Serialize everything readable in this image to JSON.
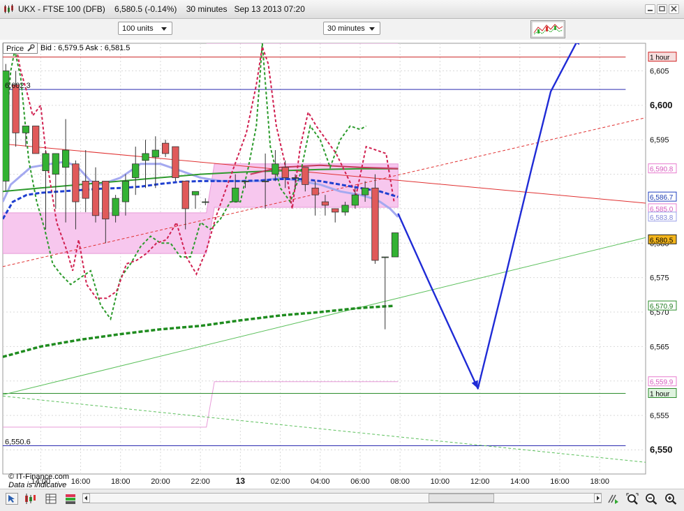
{
  "window": {
    "title": "UKX - FTSE 100 (DFB)    6,580.5 (-0.14%)    30 minutes   Sep 13 2013 07:20"
  },
  "toolbar": {
    "units_select": "100 units",
    "interval_select": "30 minutes"
  },
  "chart_header": {
    "price_label": "Price",
    "bid_ask": "Bid : 6,579.5 Ask : 6,581.5"
  },
  "footer": {
    "copyright": "© IT-Finance.com",
    "disclaimer": "Data is indicative"
  },
  "chart_data": {
    "type": "candlestick",
    "y_axis": {
      "ticks": [
        6550,
        6555,
        6560,
        6565,
        6570,
        6575,
        6580,
        6585,
        6590,
        6595,
        6600,
        6605
      ],
      "tick_labels": [
        "6,550",
        "6,555",
        "",
        "6,565",
        "6,570",
        "6,575",
        "6,580",
        "",
        "",
        "6,595",
        "6,600",
        "6,605"
      ],
      "bold": [
        6550,
        6600
      ],
      "range": [
        6546.5,
        6609.0
      ]
    },
    "x_axis": {
      "times": [
        14,
        16,
        18,
        20,
        22,
        24,
        26,
        28,
        30,
        32,
        34,
        36,
        38,
        40,
        42
      ],
      "labels": [
        "14:00",
        "16:00",
        "18:00",
        "20:00",
        "22:00",
        "13",
        "02:00",
        "04:00",
        "06:00",
        "08:00",
        "10:00",
        "12:00",
        "14:00",
        "16:00",
        "18:00"
      ],
      "range": [
        12.1,
        44.3
      ]
    },
    "candles": [
      [
        12.25,
        6589,
        6605,
        6587.5,
        6606
      ],
      [
        12.75,
        6603,
        6596,
        6594,
        6605
      ],
      [
        13.25,
        6596,
        6597,
        6594,
        6597
      ],
      [
        13.75,
        6597,
        6593,
        6593,
        6597
      ],
      [
        14.25,
        6590.5,
        6593,
        6582,
        6593.5
      ],
      [
        14.75,
        6590,
        6593,
        6585,
        6593
      ],
      [
        15.25,
        6591,
        6593.5,
        6583,
        6598
      ],
      [
        15.75,
        6591.5,
        6586,
        6582,
        6592
      ],
      [
        16.25,
        6589,
        6586.5,
        6584.5,
        6593.5
      ],
      [
        16.75,
        6589,
        6584,
        6583,
        6591
      ],
      [
        17.25,
        6589,
        6583.5,
        6580,
        6589
      ],
      [
        17.75,
        6584,
        6586.5,
        6583,
        6587
      ],
      [
        18.25,
        6586,
        6589,
        6584,
        6590
      ],
      [
        18.75,
        6589.5,
        6591.5,
        6587,
        6594
      ],
      [
        19.25,
        6592,
        6593,
        6588,
        6595
      ],
      [
        19.75,
        6592.5,
        6593.5,
        6588,
        6595.5
      ],
      [
        20.25,
        6594.5,
        6593,
        6592.5,
        6595
      ],
      [
        20.75,
        6594,
        6589.5,
        6589,
        6594
      ],
      [
        21.25,
        6589,
        6585,
        6582,
        6589
      ],
      [
        21.75,
        6587,
        6587.5,
        6585,
        6587.5
      ],
      [
        22.25,
        6586,
        6586,
        6585.5,
        6586.5
      ],
      [
        23.75,
        6586,
        6588,
        6586,
        6590
      ],
      [
        24.25,
        6589,
        6589,
        6588,
        6589
      ],
      [
        25.25,
        6589,
        6589,
        6585,
        6593
      ],
      [
        25.75,
        6590,
        6591.5,
        6589,
        6593.5
      ],
      [
        26.25,
        6591,
        6589.5,
        6588,
        6592
      ],
      [
        26.75,
        6589.5,
        6589.5,
        6588,
        6590
      ],
      [
        27.25,
        6591,
        6588.5,
        6587.5,
        6591
      ],
      [
        27.75,
        6588,
        6587,
        6584,
        6589
      ],
      [
        28.25,
        6586,
        6585.5,
        6584,
        6587
      ],
      [
        28.75,
        6585,
        6584.5,
        6583,
        6585
      ],
      [
        29.25,
        6584.5,
        6585.5,
        6584,
        6586
      ],
      [
        29.75,
        6585.5,
        6587,
        6585,
        6588
      ],
      [
        30.25,
        6587,
        6588,
        6586,
        6589
      ],
      [
        30.75,
        6588,
        6577.5,
        6577,
        6590
      ],
      [
        31.25,
        6578,
        6578,
        6567.5,
        6578
      ],
      [
        31.75,
        6578,
        6581.5,
        6578,
        6581.5
      ]
    ],
    "colors": {
      "up": "#33b233",
      "down": "#e05a5a",
      "outline": "#333333"
    },
    "price_tags": [
      {
        "label": "1 hour",
        "value": 6607.0,
        "color": "#d02020",
        "text": "#000000",
        "bg": "#f6dede"
      },
      {
        "label": "6,590.8",
        "value": 6590.8,
        "color": "#e87ccf",
        "text": "#d659bd",
        "bg": "#ffffff"
      },
      {
        "label": "6,586.7",
        "value": 6586.7,
        "color": "#2040c0",
        "text": "#1a3ab0",
        "bg": "#ffffff"
      },
      {
        "label": "6,585.0",
        "value": 6585.0,
        "color": "#e87ccf",
        "text": "#d659bd",
        "bg": "#ffffff"
      },
      {
        "label": "6,583.8",
        "value": 6583.8,
        "color": "#9aa0e8",
        "text": "#7f86d8",
        "bg": "#ffffff"
      },
      {
        "label": "6,580.5",
        "value": 6580.5,
        "color": "#222222",
        "text": "#000000",
        "bg": "#f3b51c"
      },
      {
        "label": "6,570.9",
        "value": 6570.9,
        "color": "#2b8c2b",
        "text": "#1e7a1e",
        "bg": "#ffffff"
      },
      {
        "label": "6,559.9",
        "value": 6559.9,
        "color": "#e87ccf",
        "text": "#d659bd",
        "bg": "#ffffff"
      },
      {
        "label": "1 hour",
        "value": 6558.2,
        "color": "#2b8c2b",
        "text": "#000000",
        "bg": "#dff3df"
      }
    ],
    "left_labels": [
      {
        "label": "6,602.3",
        "value": 6602.3
      },
      {
        "label": "6,550.6",
        "value": 6550.6
      }
    ],
    "hlines": [
      {
        "value": 6607.0,
        "color": "#cc2222",
        "end": 43.3
      },
      {
        "value": 6602.3,
        "color": "#2b2bb0",
        "end": 43.3
      },
      {
        "value": 6558.2,
        "color": "#2b8c2b",
        "end": 43.3
      },
      {
        "value": 6550.6,
        "color": "#2b2bb0",
        "end": 43.3
      }
    ],
    "trendlines": [
      {
        "x": [
          12.1,
          44.3
        ],
        "y": [
          6594.4,
          6585.8
        ],
        "color": "#e03030",
        "dash": false
      },
      {
        "x": [
          12.1,
          44.3
        ],
        "y": [
          6576.6,
          6598.2
        ],
        "color": "#e03030",
        "dash": true
      },
      {
        "x": [
          12.1,
          44.3
        ],
        "y": [
          6558.0,
          6580.8
        ],
        "color": "#5cc05c",
        "dash": false
      },
      {
        "x": [
          12.1,
          44.3
        ],
        "y": [
          6557.8,
          6548.2
        ],
        "color": "#5cc05c",
        "dash": true
      }
    ],
    "projection": {
      "x": [
        31.9,
        33.5,
        35.9,
        37.35,
        38.6,
        39.55,
        41.0
      ],
      "y": [
        6584.3,
        6574.0,
        6558.9,
        6576.0,
        6591.0,
        6602.0,
        6610.0
      ],
      "color": "#1f2bd6"
    },
    "band": {
      "x": [
        12.1,
        22.3,
        22.7,
        31.9
      ],
      "upper": [
        6584.4,
        6584.4,
        6591.5,
        6591.5
      ],
      "lower": [
        6578.5,
        6578.5,
        6585.2,
        6585.2
      ],
      "fill": "#f7c7ee"
    },
    "pink_lines": [
      {
        "x": [
          22.3,
          22.3,
          22.7,
          31.9
        ],
        "y": [
          6609.0,
          6609.0,
          6609.0,
          6609.0
        ]
      },
      {
        "x": [
          12.1,
          22.3,
          22.7,
          31.9
        ],
        "y": [
          6553.3,
          6553.3,
          6559.9,
          6559.9
        ]
      },
      {
        "x": [
          30.0,
          31.9
        ],
        "y": [
          6591.0,
          6591.0
        ]
      }
    ],
    "ma_green_dashed": {
      "x": [
        12.1,
        14.0,
        16.0,
        18.0,
        20.0,
        22.0,
        24.0,
        26.0,
        28.0,
        30.0,
        31.7
      ],
      "y": [
        6563.5,
        6565.0,
        6566.0,
        6566.8,
        6567.5,
        6568.0,
        6568.8,
        6569.5,
        6570.0,
        6570.6,
        6570.9
      ]
    },
    "ma_blue_dashed": {
      "x": [
        12.1,
        12.6,
        13.3,
        14.0,
        15.0,
        16.0,
        17.0,
        18.0,
        19.0,
        20.0,
        21.0,
        22.0,
        23.0,
        24.0,
        25.0,
        26.0,
        27.0,
        28.0,
        29.0,
        30.0,
        31.0,
        31.9
      ],
      "y": [
        6583.5,
        6586.0,
        6587.0,
        6587.3,
        6587.5,
        6587.7,
        6587.9,
        6588.0,
        6588.2,
        6588.6,
        6588.9,
        6589.0,
        6589.0,
        6589.0,
        6589.1,
        6589.3,
        6589.3,
        6589.0,
        6588.5,
        6588.0,
        6587.5,
        6586.7
      ]
    },
    "ma_lightblue": {
      "x": [
        12.1,
        12.5,
        13.5,
        14.5,
        15.2,
        15.8,
        16.5,
        17.0,
        18.0,
        19.0,
        20.0,
        21.0,
        22.0,
        23.0,
        24.0,
        25.0,
        26.0,
        27.0,
        28.0,
        29.0,
        30.0,
        30.6,
        31.0,
        31.5,
        31.9
      ],
      "y": [
        6586.0,
        6588.5,
        6591.0,
        6591.5,
        6591.8,
        6591.2,
        6589.0,
        6588.5,
        6589.5,
        6591.5,
        6591.5,
        6590.5,
        6589.5,
        6589.0,
        6589.0,
        6589.0,
        6589.5,
        6589.0,
        6588.5,
        6587.5,
        6587.0,
        6586.5,
        6586.0,
        6585.0,
        6583.8
      ]
    },
    "ma_green_solid": {
      "x": [
        12.1,
        14.0,
        16.0,
        18.0,
        20.0,
        22.0,
        24.0,
        26.0,
        28.0,
        30.0,
        31.9
      ],
      "y": [
        6587.5,
        6588.0,
        6588.5,
        6589.0,
        6589.5,
        6590.0,
        6590.3,
        6590.5,
        6590.7,
        6590.8,
        6590.8
      ]
    },
    "ma_darkred_solid": {
      "x": [
        24.5,
        26.0,
        28.0,
        30.0,
        31.9
      ],
      "y": [
        6590.0,
        6591.0,
        6591.3,
        6591.0,
        6590.8
      ]
    },
    "zigzag_red": {
      "x": [
        12.6,
        12.8,
        13.0,
        13.3,
        13.6,
        14.0,
        14.3,
        14.8,
        15.3,
        15.6,
        15.9,
        16.3,
        16.8,
        17.3,
        17.8,
        18.3,
        18.8,
        19.3,
        19.8,
        20.3,
        20.8,
        21.3,
        21.8,
        22.3,
        22.8,
        23.3,
        23.8,
        24.3,
        24.8,
        25.1,
        25.4,
        25.8,
        26.2,
        26.6,
        27.0,
        27.4,
        27.8,
        28.3,
        28.8,
        29.3,
        29.8,
        30.3,
        30.8,
        31.3,
        31.7
      ],
      "y": [
        6613.0,
        6608.0,
        6605.0,
        6602.0,
        6598.5,
        6600.0,
        6592.0,
        6583.0,
        6579.0,
        6576.0,
        6580.5,
        6574.0,
        6572.0,
        6572.0,
        6573.0,
        6577.0,
        6577.5,
        6578.5,
        6580.0,
        6580.5,
        6583.0,
        6578.0,
        6575.5,
        6579.0,
        6584.0,
        6588.0,
        6592.0,
        6596.0,
        6603.0,
        6608.5,
        6606.0,
        6597.0,
        6592.0,
        6585.0,
        6594.0,
        6599.0,
        6597.0,
        6595.0,
        6593.0,
        6590.0,
        6587.0,
        6594.0,
        6593.5,
        6593.0,
        6586.0
      ]
    },
    "zigzag_green": {
      "x": [
        12.3,
        12.5,
        12.7,
        13.0,
        13.4,
        13.8,
        14.2,
        14.6,
        15.0,
        15.5,
        16.0,
        16.5,
        17.0,
        17.5,
        18.0,
        18.5,
        19.0,
        19.5,
        20.0,
        20.5,
        21.0,
        21.5,
        22.0,
        22.5,
        23.0,
        23.5,
        24.0,
        24.4,
        24.8,
        25.1,
        25.5,
        26.0,
        26.5,
        27.0,
        27.5,
        28.0,
        28.5,
        29.0,
        29.5,
        30.0,
        30.3
      ],
      "y": [
        6598.0,
        6605.0,
        6608.0,
        6604.0,
        6592.0,
        6586.0,
        6582.0,
        6577.0,
        6575.5,
        6574.0,
        6575.0,
        6576.0,
        6571.0,
        6569.0,
        6575.0,
        6577.0,
        6579.5,
        6581.0,
        6580.0,
        6580.0,
        6578.0,
        6578.0,
        6583.0,
        6582.0,
        6583.5,
        6586.0,
        6586.0,
        6591.0,
        6597.0,
        6609.0,
        6594.0,
        6588.0,
        6586.0,
        6590.0,
        6597.0,
        6595.0,
        6591.0,
        6595.0,
        6597.0,
        6596.5,
        6597.0
      ]
    }
  }
}
